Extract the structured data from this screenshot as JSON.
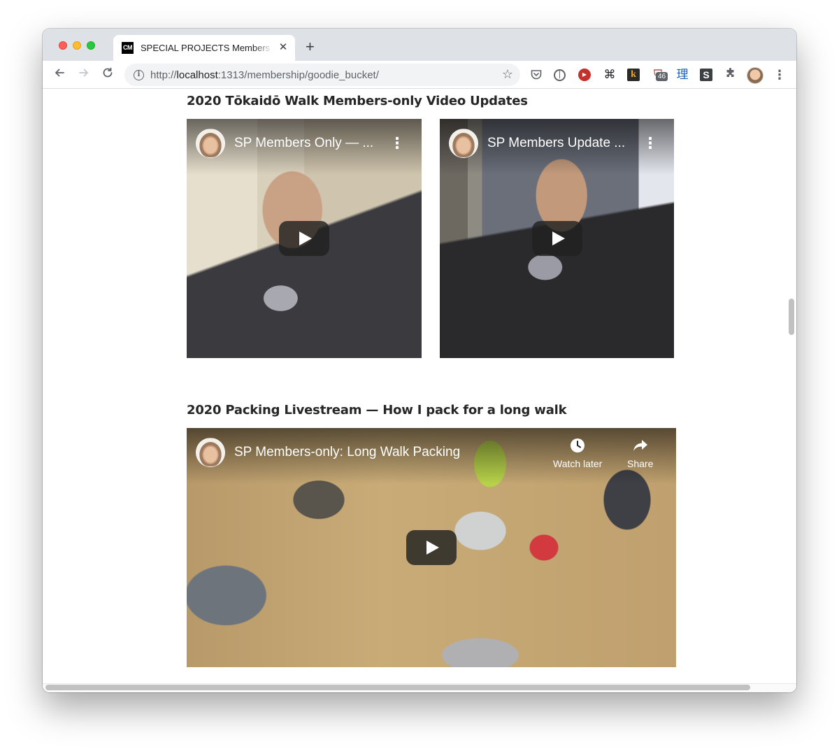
{
  "browser": {
    "tab_favicon": "CM",
    "tab_title": "SPECIAL PROJECTS Members",
    "tab_close": "✕",
    "new_tab": "+",
    "url_prefix": "http://",
    "url_host": "localhost",
    "url_rest": ":1313/membership/goodie_bucket/",
    "extension_badge": "46",
    "ext_li": "理",
    "ext_s": "S",
    "ext_k": "k"
  },
  "sections": [
    {
      "title": "2020 Tōkaidō Walk Members-only Video Updates",
      "videos": [
        {
          "title": "SP Members Only — ..."
        },
        {
          "title": "SP Members Update ..."
        }
      ]
    },
    {
      "title": "2020 Packing Livestream — How I pack for a long walk",
      "videos": [
        {
          "title": "SP Members-only: Long Walk Packing",
          "watch_later": "Watch later",
          "share": "Share"
        }
      ]
    }
  ],
  "icons": {
    "back": "back-arrow-icon",
    "forward": "forward-arrow-icon",
    "reload": "reload-icon",
    "info": "site-info-icon",
    "star": "bookmark-star-icon",
    "menu": "more-vert-icon",
    "play": "play-icon",
    "clock": "clock-icon",
    "share": "share-icon"
  },
  "colors": {
    "tabstrip": "#dee1e6",
    "play_button": "#212121",
    "youtube_red": "#c4302b"
  }
}
